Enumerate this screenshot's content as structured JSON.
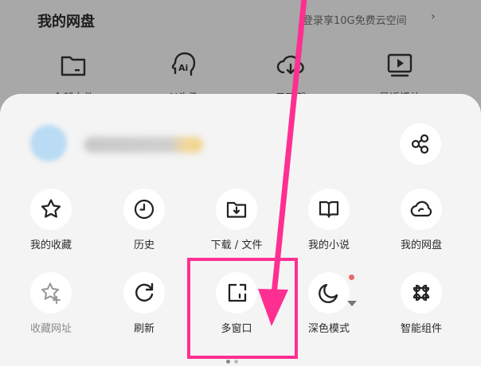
{
  "background": {
    "title": "我的网盘",
    "promo": "登录享10G免费云空间",
    "chevron": "›",
    "shortcuts": [
      {
        "label": "全部文件",
        "icon": "folder-icon"
      },
      {
        "label": "AI头像",
        "icon": "ai-head-icon"
      },
      {
        "label": "云下载",
        "icon": "cloud-download-icon"
      },
      {
        "label": "最近播放",
        "icon": "video-play-icon"
      }
    ]
  },
  "menu": {
    "row1": [
      {
        "label": "我的收藏",
        "icon": "star-icon"
      },
      {
        "label": "历史",
        "icon": "clock-icon"
      },
      {
        "label": "下载 / 文件",
        "icon": "folder-download-icon"
      },
      {
        "label": "我的小说",
        "icon": "book-icon"
      },
      {
        "label": "我的网盘",
        "icon": "cloud-icon"
      }
    ],
    "row2": [
      {
        "label": "收藏网址",
        "icon": "star-add-icon"
      },
      {
        "label": "刷新",
        "icon": "refresh-icon"
      },
      {
        "label": "多窗口",
        "icon": "multi-window-icon"
      },
      {
        "label": "深色模式",
        "icon": "moon-icon"
      },
      {
        "label": "智能组件",
        "icon": "widget-icon"
      }
    ]
  },
  "colors": {
    "annotation": "#ff2f92",
    "sheet": "#f4f4f4",
    "accent_dot": "#e86a6a"
  }
}
